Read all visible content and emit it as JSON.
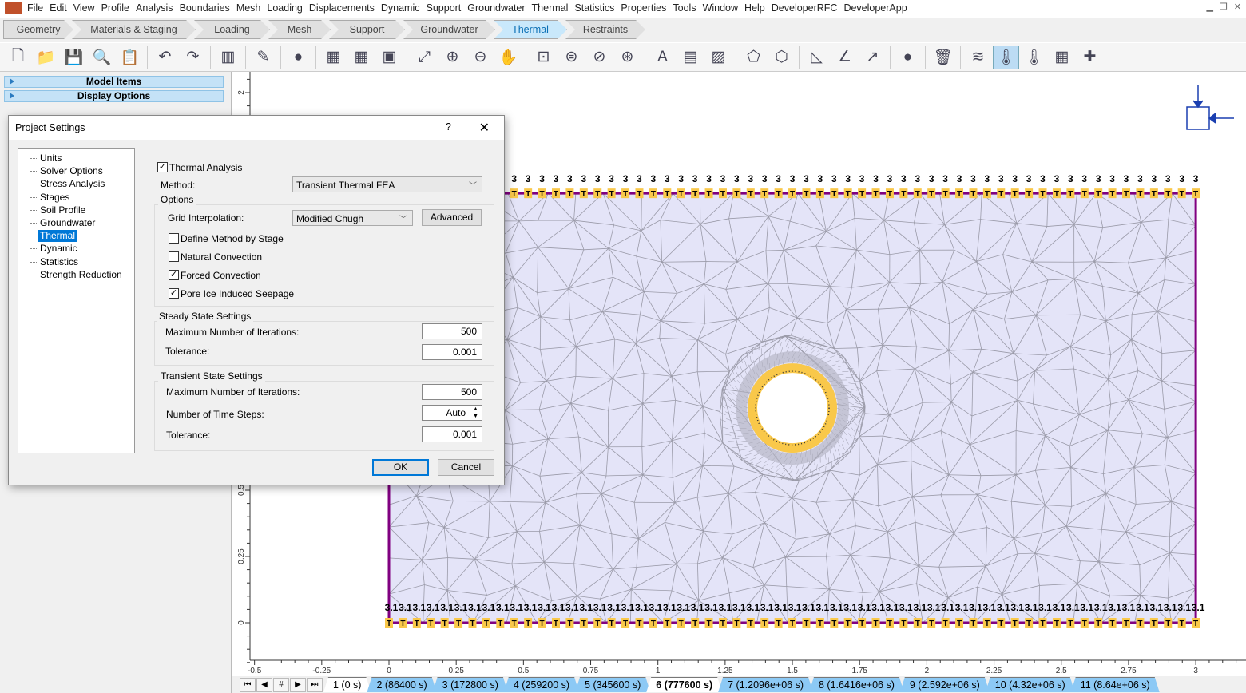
{
  "menu": [
    "File",
    "Edit",
    "View",
    "Profile",
    "Analysis",
    "Boundaries",
    "Mesh",
    "Loading",
    "Displacements",
    "Dynamic",
    "Support",
    "Groundwater",
    "Thermal",
    "Statistics",
    "Properties",
    "Tools",
    "Window",
    "Help",
    "DeveloperRFC",
    "DeveloperApp"
  ],
  "workflow": [
    {
      "label": "Geometry"
    },
    {
      "label": "Materials & Staging"
    },
    {
      "label": "Loading"
    },
    {
      "label": "Mesh"
    },
    {
      "label": "Support"
    },
    {
      "label": "Groundwater"
    },
    {
      "label": "Thermal",
      "active": true
    },
    {
      "label": "Restraints"
    }
  ],
  "toolbar": [
    [
      "new-file-icon",
      "🗋"
    ],
    [
      "open-folder-icon",
      "📁"
    ],
    [
      "save-icon",
      "💾"
    ],
    [
      "print-preview-icon",
      "🔍"
    ],
    [
      "export-icon",
      "📋"
    ],
    "|",
    [
      "undo-icon",
      "↶"
    ],
    [
      "redo-icon",
      "↷"
    ],
    "|",
    [
      "split-view-icon",
      "▥"
    ],
    "|",
    [
      "edit-icon",
      "✎"
    ],
    "|",
    [
      "color-wheel-icon",
      "●"
    ],
    "|",
    [
      "calculator-icon",
      "▦"
    ],
    [
      "calculator-2-icon",
      "▦"
    ],
    [
      "compute-icon",
      "▣"
    ],
    "|",
    [
      "zoom-all-icon",
      "⤢"
    ],
    [
      "zoom-in-icon",
      "⊕"
    ],
    [
      "zoom-out-icon",
      "⊖"
    ],
    [
      "pan-icon",
      "✋"
    ],
    "|",
    [
      "zoom-window-icon",
      "⊡"
    ],
    [
      "zoom-extents-icon",
      "⊜"
    ],
    [
      "zoom-previous-icon",
      "⊘"
    ],
    [
      "zoom-lock-icon",
      "⊛"
    ],
    "|",
    [
      "text-box-icon",
      "A"
    ],
    [
      "table-icon",
      "▤"
    ],
    [
      "image-icon",
      "▨"
    ],
    "|",
    [
      "polyline-icon",
      "⬠"
    ],
    [
      "polygon-icon",
      "⬡"
    ],
    "|",
    [
      "measure-angle-icon",
      "◺"
    ],
    [
      "angle-icon",
      "∠"
    ],
    [
      "arrow-icon",
      "↗"
    ],
    "|",
    [
      "sphere-icon",
      "●"
    ],
    "|",
    [
      "delete-icon",
      "🗑"
    ],
    "|",
    [
      "material-layers-icon",
      "≋"
    ],
    [
      "thermal-boundary-icon",
      "🌡",
      true
    ],
    [
      "temperature-icon",
      "🌡"
    ],
    [
      "grid-table-icon",
      "▦"
    ],
    [
      "add-point-icon",
      "✚"
    ]
  ],
  "left_panel": {
    "model_items": "Model Items",
    "display_options": "Display Options"
  },
  "dialog": {
    "title": "Project Settings",
    "help": "?",
    "close": "✕",
    "tree": [
      "Units",
      "Solver Options",
      "Stress Analysis",
      "Stages",
      "Soil Profile",
      "Groundwater",
      "Thermal",
      "Dynamic",
      "Statistics",
      "Strength Reduction"
    ],
    "selected": "Thermal",
    "thermal_analysis": {
      "label": "Thermal Analysis",
      "checked": true
    },
    "method_label": "Method:",
    "method_value": "Transient Thermal FEA",
    "options_label": "Options",
    "grid_label": "Grid Interpolation:",
    "grid_value": "Modified Chugh",
    "advanced": "Advanced",
    "checks": [
      {
        "label": "Define Method by Stage",
        "checked": false
      },
      {
        "label": "Natural Convection",
        "checked": false
      },
      {
        "label": "Forced Convection",
        "checked": true
      },
      {
        "label": "Pore Ice Induced Seepage",
        "checked": true
      }
    ],
    "steady": {
      "title": "Steady State Settings",
      "max_label": "Maximum Number of Iterations:",
      "max_value": "500",
      "tol_label": "Tolerance:",
      "tol_value": "0.001"
    },
    "transient": {
      "title": "Transient State Settings",
      "max_label": "Maximum Number of Iterations:",
      "max_value": "500",
      "steps_label": "Number of Time Steps:",
      "steps_value": "Auto",
      "tol_label": "Tolerance:",
      "tol_value": "0.001"
    },
    "ok": "OK",
    "cancel": "Cancel"
  },
  "axes": {
    "x_ticks": [
      "-0.5",
      "-0.25",
      "0",
      "0.25",
      "0.5",
      "0.75",
      "1",
      "1.25",
      "1.5",
      "1.75",
      "2",
      "2.25",
      "2.5",
      "2.75",
      "3"
    ],
    "y_ticks": [
      "0",
      "0.25",
      "0.5",
      "2"
    ]
  },
  "boundary": {
    "top_value": "3",
    "bottom_value": "3.1",
    "marker": "T",
    "color_boundary": "#800080",
    "color_marker": "#f9c84a",
    "color_mesh_fill": "#e4e4f8"
  },
  "stages": {
    "nav": [
      "⏮",
      "◀",
      "#",
      "▶",
      "⏭"
    ],
    "tabs": [
      "1 (0 s)",
      "2 (86400 s)",
      "3 (172800 s)",
      "4 (259200 s)",
      "5 (345600 s)",
      "6 (777600 s)",
      "7 (1.2096e+06 s)",
      "8 (1.6416e+06 s)",
      "9 (2.592e+06 s)",
      "10 (4.32e+06 s)",
      "11 (8.64e+06 s)"
    ],
    "current": "6 (777600 s)"
  }
}
